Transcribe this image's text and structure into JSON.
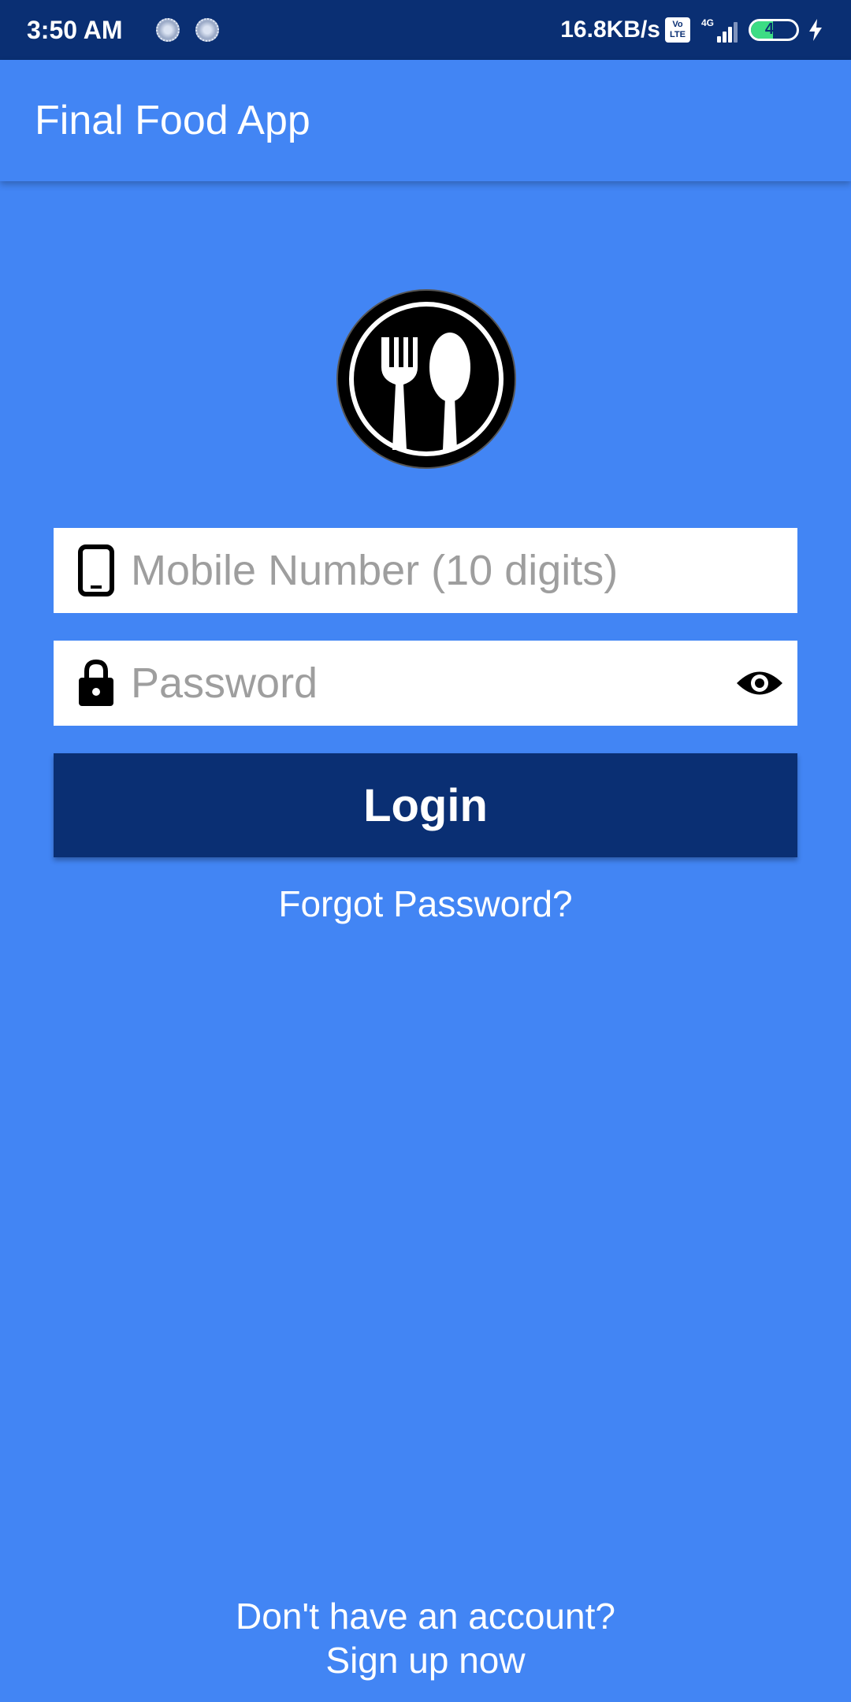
{
  "status_bar": {
    "time": "3:50 AM",
    "net_speed": "16.8KB/s",
    "volte_top": "Vo",
    "volte_bottom": "LTE",
    "network_type": "4G",
    "battery_level": "49",
    "battery_fraction": 0.49,
    "icons": [
      "sync-spinner-icon",
      "sync-spinner-icon",
      "volte-icon",
      "signal-icon",
      "battery-icon",
      "charging-bolt-icon"
    ]
  },
  "app_bar": {
    "title": "Final Food App"
  },
  "logo": {
    "icon": "fork-spoon-logo-icon"
  },
  "form": {
    "mobile": {
      "placeholder": "Mobile Number (10 digits)",
      "value": "",
      "icon": "phone-icon"
    },
    "password": {
      "placeholder": "Password",
      "value": "",
      "icon": "lock-icon",
      "toggle_icon": "eye-icon"
    },
    "login_label": "Login",
    "forgot_label": "Forgot Password?"
  },
  "footer": {
    "question": "Don't have an account?",
    "signup_label": "Sign up now"
  },
  "colors": {
    "background": "#4285F4",
    "status_bar": "#0A2F73",
    "button": "#0A2F73",
    "text": "#FFFFFF"
  }
}
